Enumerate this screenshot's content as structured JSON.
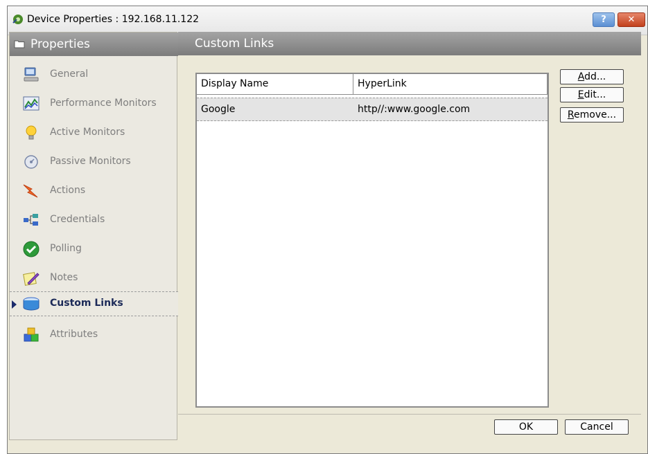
{
  "window": {
    "title": "Device Properties : 192.168.11.122",
    "help_label": "?",
    "close_label": "✕"
  },
  "left_panel": {
    "header": "Properties",
    "items": [
      {
        "label": "General",
        "icon": "computer-icon",
        "selected": false
      },
      {
        "label": "Performance Monitors",
        "icon": "chart-icon",
        "selected": false
      },
      {
        "label": "Active Monitors",
        "icon": "lightbulb-icon",
        "selected": false
      },
      {
        "label": "Passive Monitors",
        "icon": "satellite-dish-icon",
        "selected": false
      },
      {
        "label": "Actions",
        "icon": "lightning-icon",
        "selected": false
      },
      {
        "label": "Credentials",
        "icon": "network-icon",
        "selected": false
      },
      {
        "label": "Polling",
        "icon": "checkmark-icon",
        "selected": false
      },
      {
        "label": "Notes",
        "icon": "pencil-note-icon",
        "selected": false
      },
      {
        "label": "Custom Links",
        "icon": "link-box-icon",
        "selected": true
      },
      {
        "label": "Attributes",
        "icon": "blocks-icon",
        "selected": false
      }
    ]
  },
  "right_panel": {
    "header": "Custom Links",
    "table": {
      "columns": [
        "Display Name",
        "HyperLink"
      ],
      "rows": [
        [
          "Google",
          "http//:www.google.com"
        ]
      ]
    },
    "buttons": {
      "add": {
        "mnemonic": "A",
        "rest": "dd..."
      },
      "edit": {
        "mnemonic": "E",
        "rest": "dit..."
      },
      "remove": {
        "mnemonic": "R",
        "rest": "emove..."
      }
    }
  },
  "footer": {
    "ok_label": "OK",
    "cancel_label": "Cancel"
  },
  "colors": {
    "header_gradient_top": "#a4a4a4",
    "header_gradient_bottom": "#7c7c7c",
    "selected_text": "#1c2a58",
    "close_button": "#c2411d"
  }
}
